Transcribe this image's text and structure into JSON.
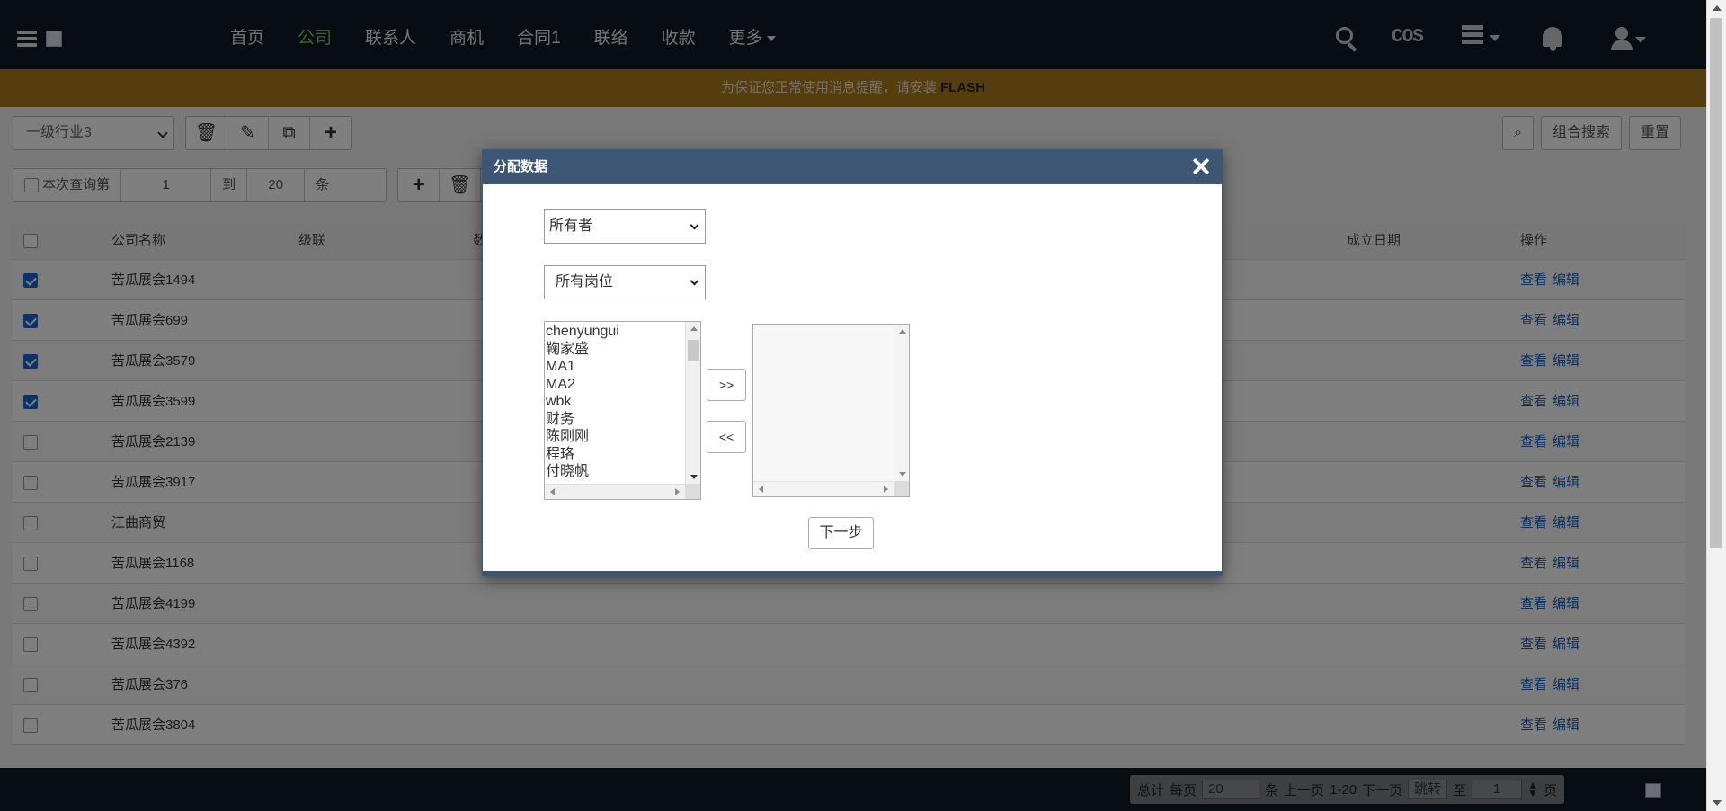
{
  "nav": {
    "items": [
      {
        "label": "首页",
        "active": false
      },
      {
        "label": "公司",
        "active": true
      },
      {
        "label": "联系人",
        "active": false
      },
      {
        "label": "商机",
        "active": false
      },
      {
        "label": "合同1",
        "active": false
      },
      {
        "label": "联络",
        "active": false
      },
      {
        "label": "收款",
        "active": false
      },
      {
        "label": "更多",
        "active": false
      }
    ],
    "cos_label": "COS",
    "active_color": "#7ac943"
  },
  "flash": {
    "text": "为保证您正常使用消息提醒，请安装",
    "highlight": "FLASH"
  },
  "toolbar": {
    "industry_select": "一级行业3",
    "combo_search": "组合搜索",
    "reset": "重置",
    "query_label": "本次查询第",
    "from": "1",
    "to_label": "到",
    "to": "20",
    "unit": "条"
  },
  "table": {
    "headers": {
      "name": "公司名称",
      "level": "级联",
      "col3": "数",
      "date": "成立日期",
      "ops": "操作"
    },
    "rows": [
      {
        "name": "苦瓜展会1494",
        "checked": true
      },
      {
        "name": "苦瓜展会699",
        "checked": true
      },
      {
        "name": "苦瓜展会3579",
        "checked": true
      },
      {
        "name": "苦瓜展会3599",
        "checked": true
      },
      {
        "name": "苦瓜展会2139",
        "checked": false
      },
      {
        "name": "苦瓜展会3917",
        "checked": false
      },
      {
        "name": "江曲商贸",
        "checked": false
      },
      {
        "name": "苦瓜展会1168",
        "checked": false
      },
      {
        "name": "苦瓜展会4199",
        "checked": false
      },
      {
        "name": "苦瓜展会4392",
        "checked": false
      },
      {
        "name": "苦瓜展会376",
        "checked": false
      },
      {
        "name": "苦瓜展会3804",
        "checked": false
      }
    ],
    "view_label": "查看",
    "edit_label": "编辑"
  },
  "footer": {
    "total": "总计",
    "per_page": "每页",
    "page_size": "20",
    "unit": "条",
    "prev": "上一页",
    "range": "1-20",
    "next": "下一页",
    "jump": "跳转",
    "to": "至",
    "page_value": "1",
    "page_unit": "页"
  },
  "modal": {
    "title": "分配数据",
    "owner_select": "所有者",
    "position_select": "所有岗位",
    "users": [
      "chenyungui",
      "鞠家盛",
      "MA1",
      "MA2",
      "wbk",
      "财务",
      "陈刚刚",
      "程珞",
      "付晓帆"
    ],
    "add_label": ">>",
    "remove_label": "<<",
    "next_label": "下一步",
    "header_color": "#3c5674"
  }
}
